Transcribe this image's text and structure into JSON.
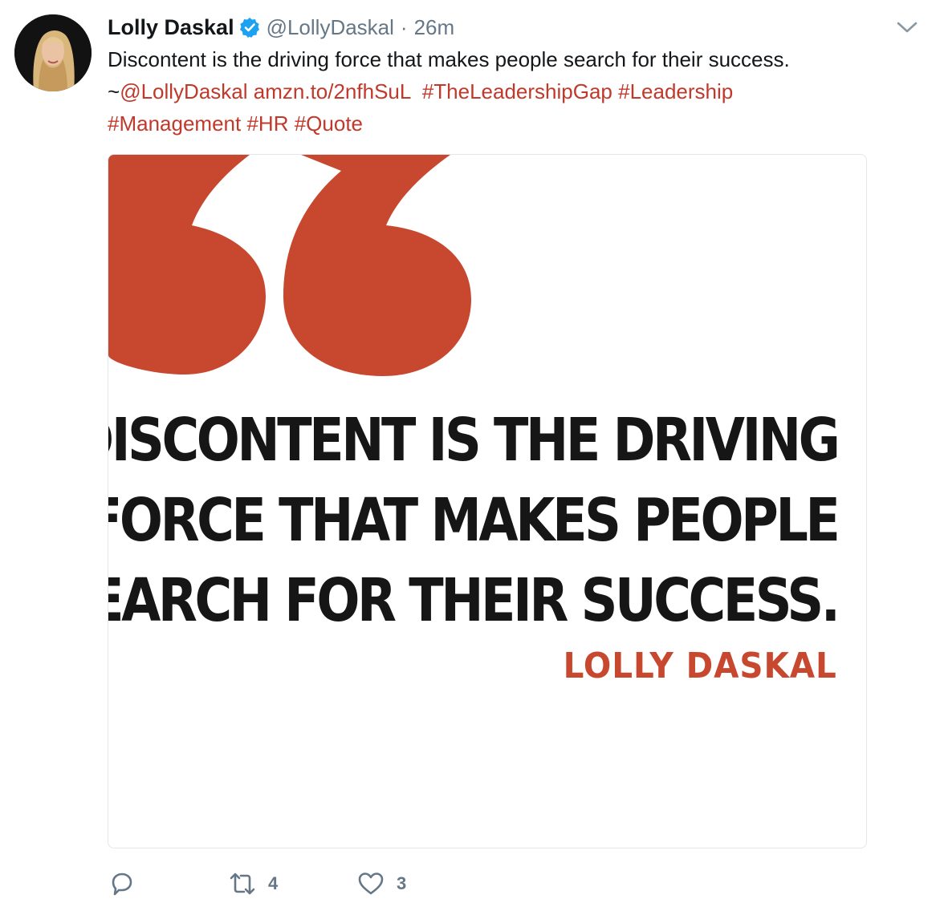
{
  "tweet": {
    "author": {
      "display_name": "Lolly Daskal",
      "handle": "@LollyDaskal",
      "verified": true,
      "avatar_icon": "avatar-photo"
    },
    "separator": "·",
    "timestamp": "26m",
    "text_lines": [
      [
        {
          "text": "Discontent is the driving force that makes people search for their success.",
          "type": "text"
        }
      ],
      [
        {
          "text": "~",
          "type": "text"
        },
        {
          "text": "@LollyDaskal",
          "type": "link"
        },
        {
          "text": " ",
          "type": "text"
        },
        {
          "text": "amzn.to/2nfhSuL",
          "type": "link"
        },
        {
          "text": "  ",
          "type": "text"
        },
        {
          "text": "#TheLeadershipGap",
          "type": "link"
        },
        {
          "text": " ",
          "type": "text"
        },
        {
          "text": "#Leadership",
          "type": "link"
        }
      ],
      [
        {
          "text": "#Management",
          "type": "link"
        },
        {
          "text": " ",
          "type": "text"
        },
        {
          "text": "#HR",
          "type": "link"
        },
        {
          "text": " ",
          "type": "text"
        },
        {
          "text": "#Quote",
          "type": "link"
        }
      ]
    ],
    "media": {
      "quote_lines": [
        "DISCONTENT IS THE DRIVING",
        "FORCE THAT MAKES PEOPLE",
        "SEARCH FOR THEIR SUCCESS."
      ],
      "quote_author": "LOLLY DASKAL",
      "quote_mark_icon": "quote-marks-icon"
    },
    "actions": {
      "reply_icon": "reply-icon",
      "retweet_icon": "retweet-icon",
      "retweet_count": "4",
      "like_icon": "heart-icon",
      "like_count": "3"
    },
    "menu_icon": "chevron-down-icon"
  },
  "colors": {
    "link": "#c0392b",
    "quote_accent": "#c8472f",
    "muted": "#657786",
    "verified": "#1da1f2"
  }
}
